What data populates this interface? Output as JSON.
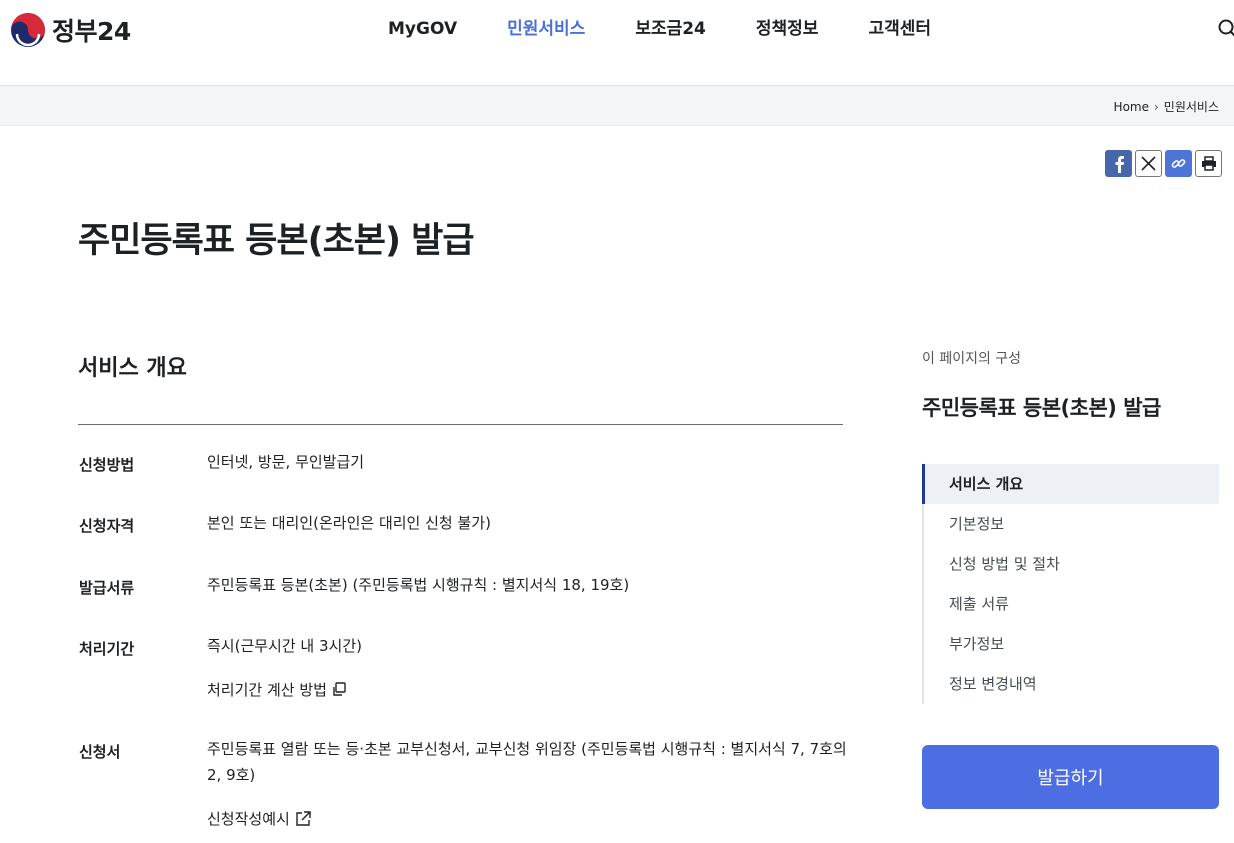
{
  "header": {
    "logo_text": "정부24",
    "nav": [
      "MyGOV",
      "민원서비스",
      "보조금24",
      "정책정보",
      "고객센터"
    ],
    "active_nav": "민원서비스"
  },
  "breadcrumb": {
    "home": "Home",
    "current": "민원서비스"
  },
  "share": [
    "facebook-share",
    "x-share",
    "copy-link",
    "print"
  ],
  "page": {
    "title": "주민등록표 등본(초본) 발급"
  },
  "overview": {
    "section_title": "서비스 개요",
    "rows": [
      {
        "label": "신청방법",
        "value": "인터넷, 방문, 무인발급기"
      },
      {
        "label": "신청자격",
        "value": "본인 또는 대리인(온라인은 대리인 신청 불가)"
      },
      {
        "label": "발급서류",
        "value": "주민등록표 등본(초본) (주민등록법 시행규칙 : 별지서식 18, 19호)"
      },
      {
        "label": "처리기간",
        "value": "즉시(근무시간 내 3시간)",
        "link": "처리기간 계산 방법"
      },
      {
        "label": "신청서",
        "value": "주민등록표 열람 또는 등·초본 교부신청서, 교부신청 위임장 (주민등록법 시행규칙 : 별지서식 7, 7호의2, 9호)",
        "link": "신청작성예시"
      }
    ]
  },
  "side": {
    "caption": "이 페이지의 구성",
    "title": "주민등록표 등본(초본) 발급",
    "toc": [
      "서비스 개요",
      "기본정보",
      "신청 방법 및 절차",
      "제출 서류",
      "부가정보",
      "정보 변경내역"
    ],
    "apply_label": "발급하기"
  },
  "colors": {
    "accent": "#4a6fd8",
    "button": "#4d6ee3",
    "toc_active_bar": "#1f3a93"
  }
}
